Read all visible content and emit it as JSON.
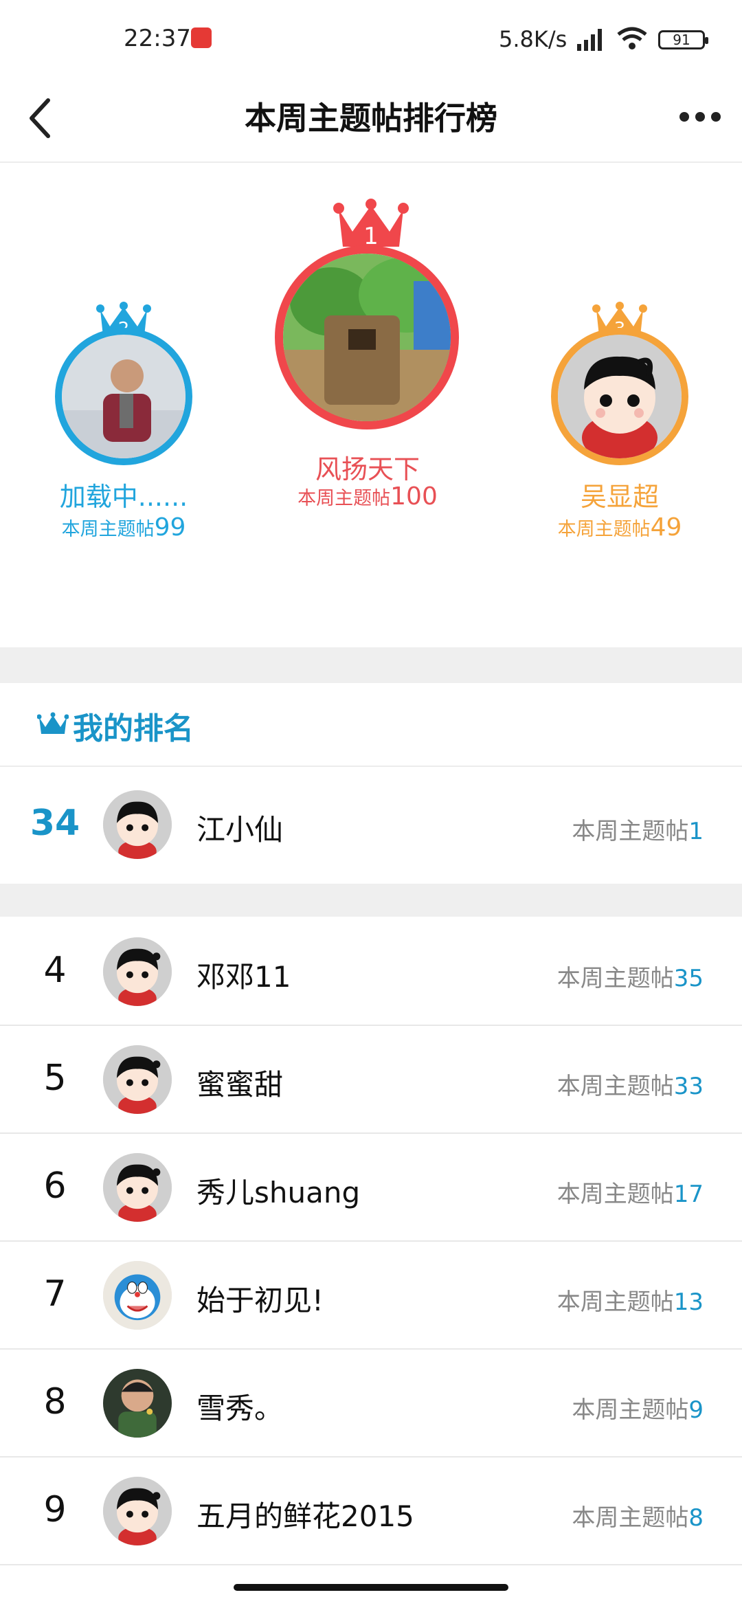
{
  "status_bar": {
    "time": "22:37",
    "net_speed": "5.8K/s",
    "battery": "91"
  },
  "header": {
    "title": "本周主题帖排行榜"
  },
  "podium": {
    "first": {
      "rank": "1",
      "name": "风扬天下",
      "label": "本周主题帖",
      "count": "100",
      "color": "#f0474b"
    },
    "second": {
      "rank": "2",
      "name": "加载中......",
      "label": "本周主题帖",
      "count": "99",
      "color": "#21a5dd"
    },
    "third": {
      "rank": "3",
      "name": "吴显超",
      "label": "本周主题帖",
      "count": "49",
      "color": "#f5a33a"
    }
  },
  "my_rank": {
    "heading": "我的排名",
    "rank": "34",
    "name": "江小仙",
    "label": "本周主题帖",
    "count": "1"
  },
  "list": [
    {
      "rank": "4",
      "name": "邓邓11",
      "label": "本周主题帖",
      "count": "35",
      "avatar": "cartoon-girl"
    },
    {
      "rank": "5",
      "name": "蜜蜜甜",
      "label": "本周主题帖",
      "count": "33",
      "avatar": "cartoon-girl"
    },
    {
      "rank": "6",
      "name": "秀儿shuang",
      "label": "本周主题帖",
      "count": "17",
      "avatar": "cartoon-girl"
    },
    {
      "rank": "7",
      "name": "始于初见!",
      "label": "本周主题帖",
      "count": "13",
      "avatar": "doraemon"
    },
    {
      "rank": "8",
      "name": "雪秀。",
      "label": "本周主题帖",
      "count": "9",
      "avatar": "photo-child"
    },
    {
      "rank": "9",
      "name": "五月的鲜花2015",
      "label": "本周主题帖",
      "count": "8",
      "avatar": "cartoon-girl"
    }
  ],
  "colors": {
    "accent": "#1a94c8",
    "gold": "#f5a33a",
    "red": "#f0474b"
  }
}
